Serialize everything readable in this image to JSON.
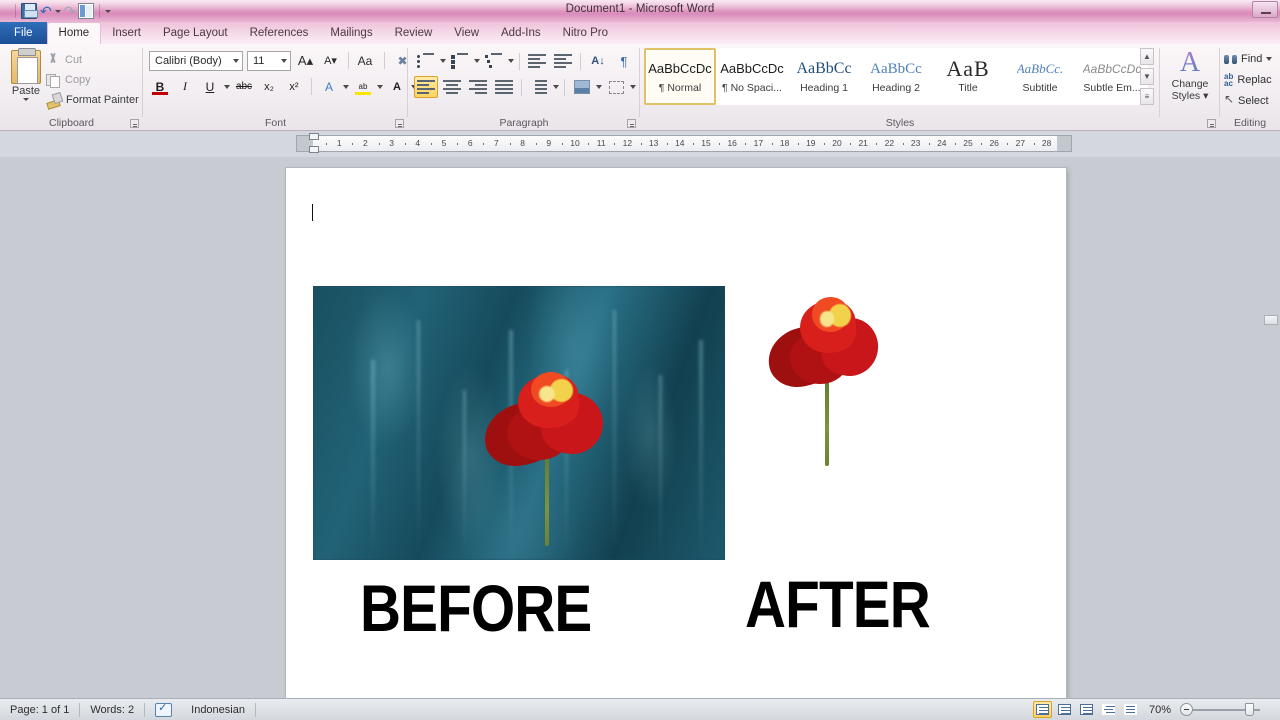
{
  "window": {
    "title": "Document1  -  Microsoft Word",
    "quick_access": [
      {
        "name": "save",
        "label": "Save"
      },
      {
        "name": "undo",
        "label": "Undo"
      },
      {
        "name": "redo",
        "label": "Redo"
      },
      {
        "name": "print-preview",
        "label": "Print Preview and Print"
      }
    ],
    "controls": [
      {
        "name": "minimize",
        "label": "Minimize"
      }
    ]
  },
  "tabs": [
    {
      "id": "file",
      "label": "File"
    },
    {
      "id": "home",
      "label": "Home"
    },
    {
      "id": "insert",
      "label": "Insert"
    },
    {
      "id": "page-layout",
      "label": "Page Layout"
    },
    {
      "id": "references",
      "label": "References"
    },
    {
      "id": "mailings",
      "label": "Mailings"
    },
    {
      "id": "review",
      "label": "Review"
    },
    {
      "id": "view",
      "label": "View"
    },
    {
      "id": "add-ins",
      "label": "Add-Ins"
    },
    {
      "id": "nitro-pro",
      "label": "Nitro Pro"
    }
  ],
  "active_tab": "home",
  "ribbon": {
    "clipboard": {
      "label": "Clipboard",
      "paste": "Paste",
      "cut": "Cut",
      "copy": "Copy",
      "format_painter": "Format Painter"
    },
    "font": {
      "label": "Font",
      "font_name": "Calibri (Body)",
      "font_size": "11",
      "grow_font": "A",
      "shrink_font": "A",
      "change_case": "Aa",
      "clear_formatting": "clear-formatting",
      "bold": "B",
      "italic": "I",
      "underline": "U",
      "strikethrough": "abc",
      "subscript": "x₂",
      "superscript": "x²",
      "text_effects": "A",
      "highlight": "ab",
      "font_color": "A"
    },
    "paragraph": {
      "label": "Paragraph",
      "bullets": "bullets",
      "numbering": "numbering",
      "multilevel": "multilevel-list",
      "decrease_indent": "decrease-indent",
      "increase_indent": "increase-indent",
      "sort": "A\nZ",
      "show_marks": "¶",
      "align_left": "align-left",
      "align_center": "align-center",
      "align_right": "align-right",
      "justify": "justify",
      "line_spacing": "line-spacing",
      "shading": "shading",
      "borders": "borders",
      "active_alignment": "align_left"
    },
    "styles": {
      "label": "Styles",
      "items": [
        {
          "preview": "AaBbCcDc",
          "name": "¶ Normal",
          "selected": true
        },
        {
          "preview": "AaBbCcDc",
          "name": "¶ No Spaci...",
          "selected": false
        },
        {
          "preview": "AaBbCс",
          "name": "Heading 1",
          "selected": false
        },
        {
          "preview": "AaBbCc",
          "name": "Heading 2",
          "selected": false
        },
        {
          "preview": "AaB",
          "name": "Title",
          "selected": false
        },
        {
          "preview": "AaBbCc.",
          "name": "Subtitle",
          "selected": false
        },
        {
          "preview": "AaBbCcDc",
          "name": "Subtle Em...",
          "selected": false
        }
      ]
    },
    "change_styles": {
      "line1": "Change",
      "line2": "Styles"
    },
    "editing": {
      "label": "Editing",
      "find": "Find",
      "replace": "Replac",
      "select": "Select"
    }
  },
  "ruler": {
    "numbers": [
      "1",
      "2",
      "3",
      "4",
      "5",
      "6",
      "7",
      "8",
      "9",
      "10",
      "11",
      "12",
      "13",
      "14",
      "15",
      "16",
      "17",
      "18",
      "19",
      "20",
      "21",
      "22",
      "23",
      "24",
      "25",
      "26",
      "27",
      "28"
    ]
  },
  "document": {
    "before_caption": "BEFORE",
    "after_caption": "AFTER",
    "before_image_alt": "red-poppy-on-teal-background-photo",
    "after_image_alt": "red-poppy-with-background-removed"
  },
  "status": {
    "page": "Page: 1 of 1",
    "words": "Words: 2",
    "language": "Indonesian",
    "zoom": "70%",
    "views": [
      {
        "name": "print-layout",
        "selected": true
      },
      {
        "name": "full-screen-reading",
        "selected": false
      },
      {
        "name": "web-layout",
        "selected": false
      },
      {
        "name": "outline",
        "selected": false
      },
      {
        "name": "draft",
        "selected": false
      }
    ]
  },
  "colors": {
    "accent": "#1c4f95",
    "title_bar": "#e6a7c9",
    "photo_bg": "#1c4a5c",
    "flower": "#c8161a",
    "selection": "#ffd35e"
  }
}
